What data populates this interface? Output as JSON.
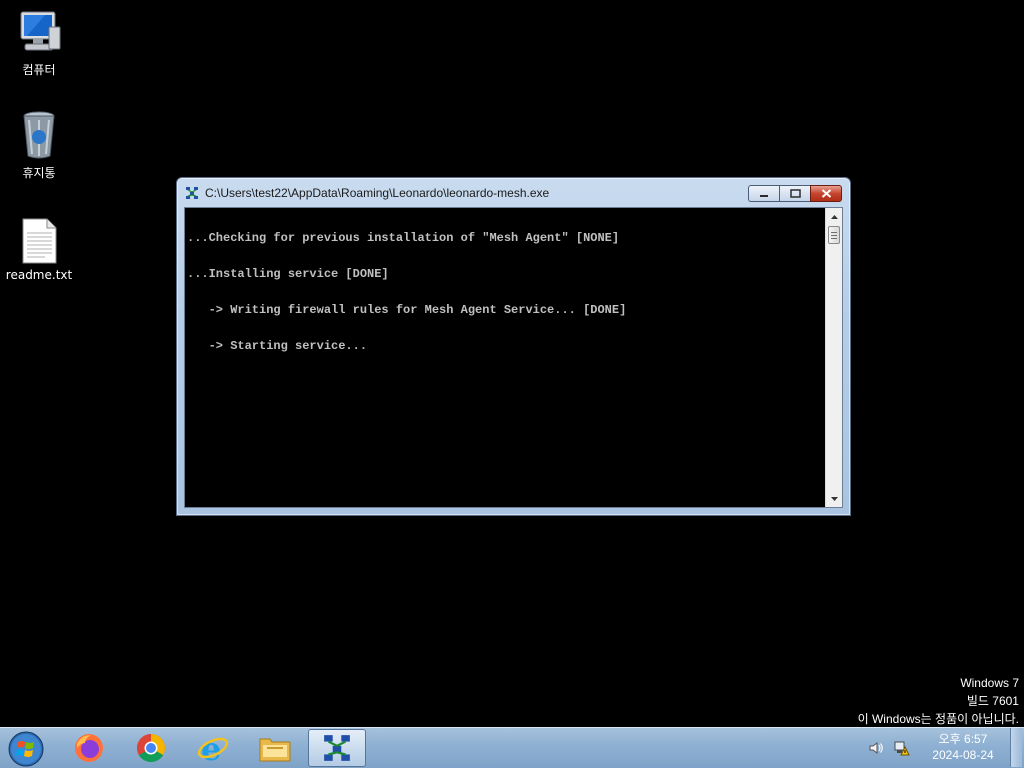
{
  "desktop": {
    "icons": [
      {
        "label": "컴퓨터",
        "icon": "computer-icon"
      },
      {
        "label": "휴지통",
        "icon": "recycle-bin-icon"
      },
      {
        "label": "readme.txt",
        "icon": "text-file-icon"
      }
    ]
  },
  "window": {
    "title": "C:\\Users\\test22\\AppData\\Roaming\\Leonardo\\leonardo-mesh.exe",
    "icon": "mesh-agent-icon",
    "console_lines": [
      "...Checking for previous installation of \"Mesh Agent\" [NONE]",
      "...Installing service [DONE]",
      "   -> Writing firewall rules for Mesh Agent Service... [DONE]",
      "   -> Starting service..."
    ]
  },
  "watermark": {
    "line1": "Windows 7",
    "line2": "빌드 7601",
    "line3": "이 Windows는 정품이 아닙니다."
  },
  "taskbar": {
    "start_icon": "windows-start-icon",
    "pinned": [
      "firefox-icon",
      "chrome-icon",
      "internet-explorer-icon",
      "file-explorer-icon",
      "mesh-agent-icon"
    ],
    "clock": {
      "time": "오후 6:57",
      "date": "2024-08-24"
    }
  },
  "colors": {
    "desktop_bg": "#000000",
    "console_text": "#c0c0c0",
    "taskbar": "#8eb0d2"
  }
}
